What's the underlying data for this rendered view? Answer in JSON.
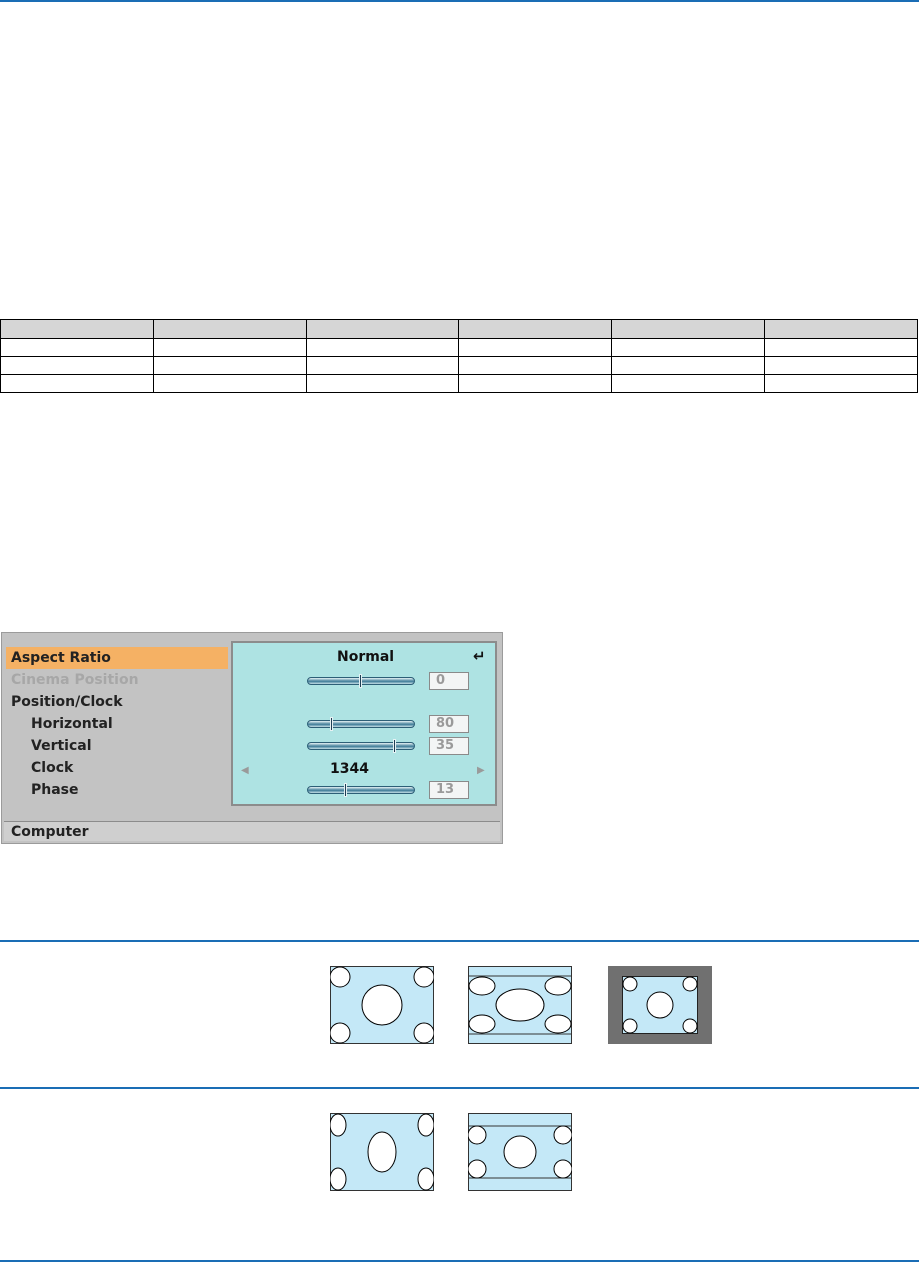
{
  "menu": {
    "items": [
      {
        "label": "Aspect Ratio",
        "state": "selected"
      },
      {
        "label": "Cinema Position",
        "state": "disabled"
      },
      {
        "label": "Position/Clock",
        "state": "normal"
      },
      {
        "label": "Horizontal",
        "state": "sub"
      },
      {
        "label": "Vertical",
        "state": "sub"
      },
      {
        "label": "Clock",
        "state": "sub"
      },
      {
        "label": "Phase",
        "state": "sub"
      }
    ],
    "aspect_value": "Normal",
    "enter_symbol": "↵",
    "cinema_position": {
      "value": "0",
      "level": 0.5
    },
    "horizontal": {
      "value": "80",
      "level": 0.22
    },
    "vertical": {
      "value": "35",
      "level": 0.83
    },
    "clock_value": "1344",
    "phase": {
      "value": "13",
      "level": 0.35
    },
    "footer": "Computer"
  },
  "icons": {
    "enter": "enter-icon",
    "left": "left-arrow-icon",
    "right": "right-arrow-icon"
  },
  "colors": {
    "rule": "#1a6db5",
    "menu_selected": "#f5b164",
    "panel": "#aee3e3",
    "diagram_fill": "#c4e8f7",
    "frame_gray": "#707070"
  }
}
